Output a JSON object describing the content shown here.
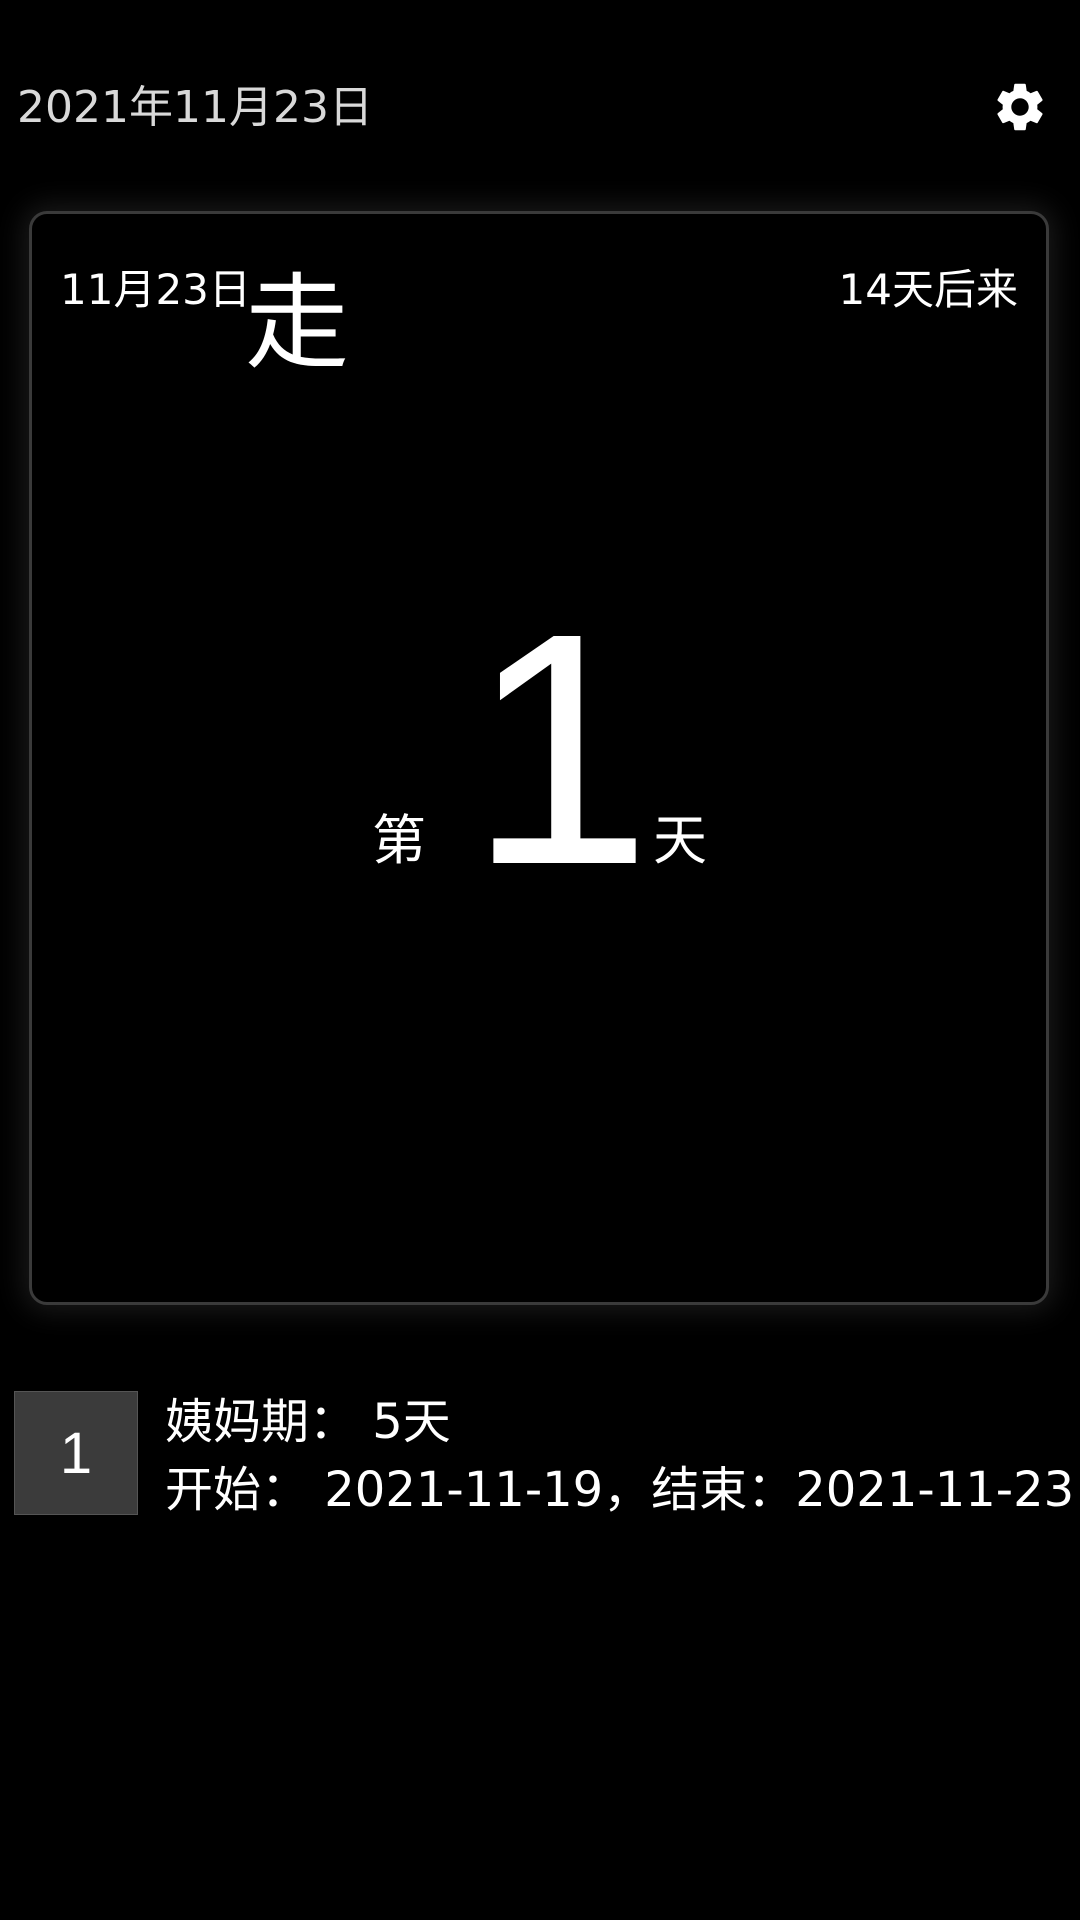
{
  "header": {
    "date": "2021年11月23日",
    "settings_icon": "gear-icon"
  },
  "card": {
    "date": "11月23日",
    "status": "走",
    "next_period": "14天后来",
    "day_prefix": "第",
    "day_number": "1",
    "day_suffix": "天"
  },
  "records": [
    {
      "index": "1",
      "line1": "姨妈期： 5天",
      "line2": "开始： 2021-11-19，结束：2021-11-23"
    }
  ],
  "colors": {
    "background": "#000000",
    "text": "#ffffff",
    "header_text": "#d9d9d9",
    "card_border": "#3a3a3a",
    "record_index_bg": "#3b3b3b"
  }
}
